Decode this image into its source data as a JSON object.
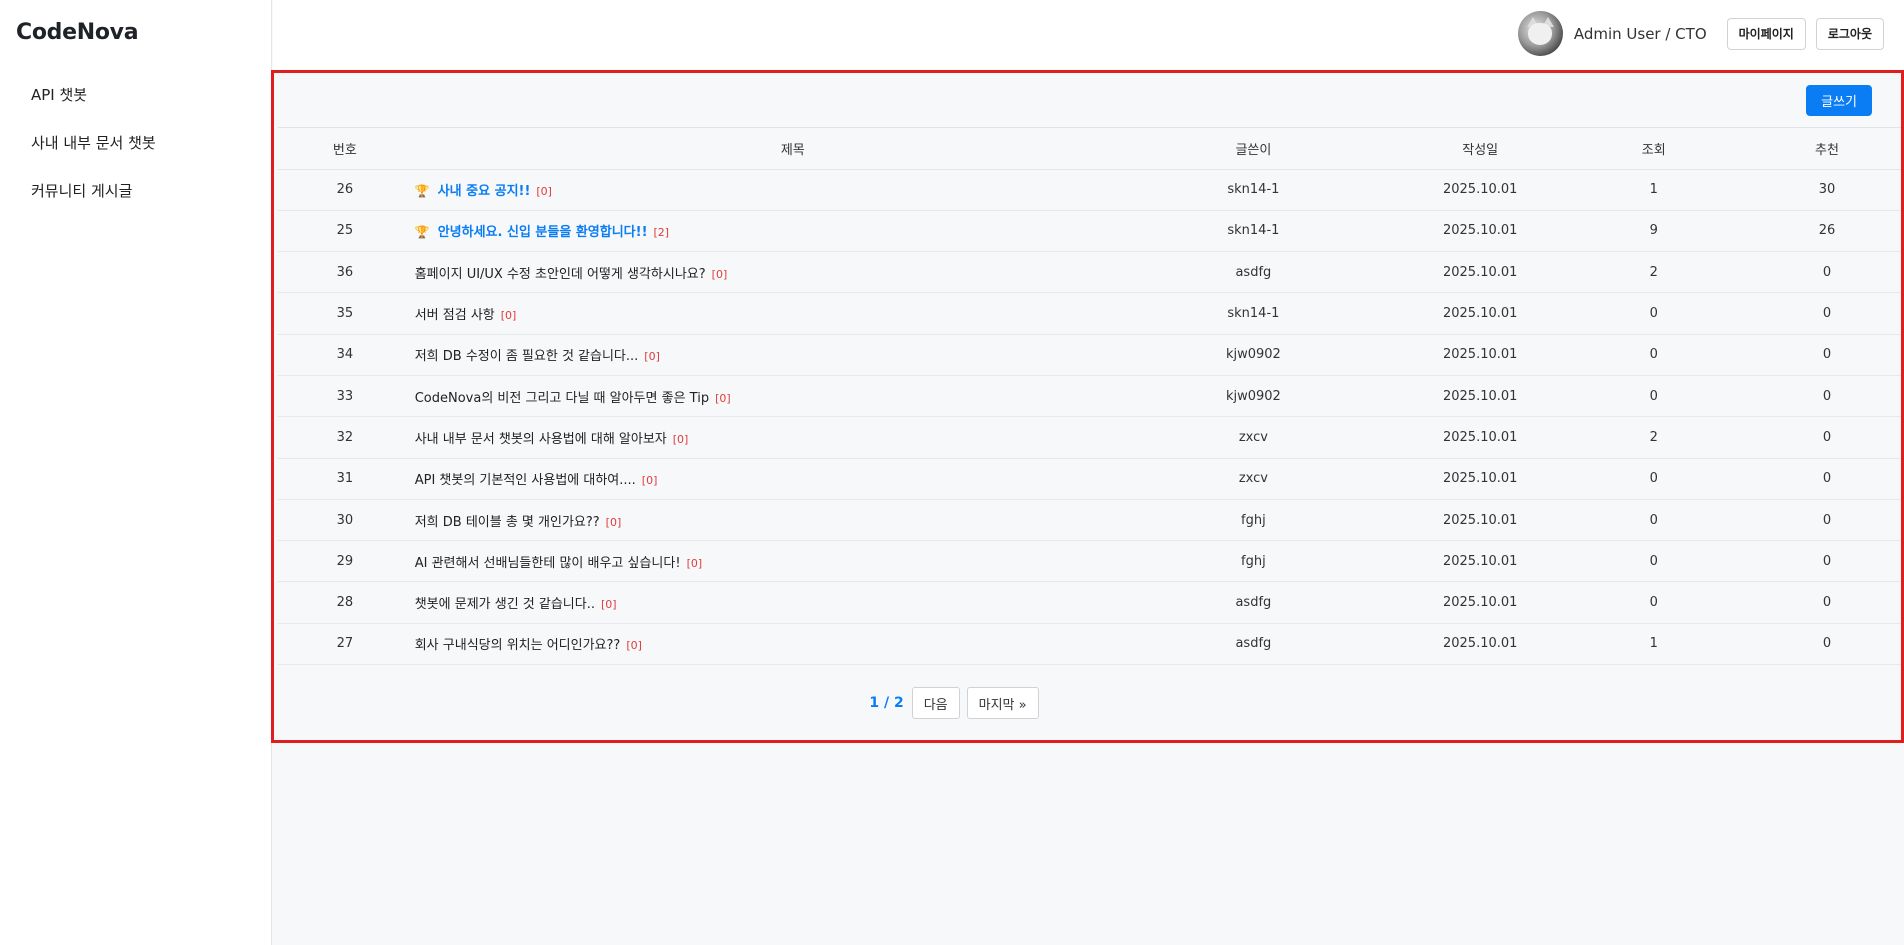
{
  "app": {
    "logo": "CodeNova"
  },
  "sidebar": {
    "items": [
      {
        "label": "API 챗봇"
      },
      {
        "label": "사내 내부 문서 챗봇"
      },
      {
        "label": "커뮤니티 게시글"
      }
    ]
  },
  "header": {
    "user_label": "Admin User / CTO",
    "mypage_label": "마이페이지",
    "logout_label": "로그아웃"
  },
  "board": {
    "write_label": "글쓰기",
    "columns": {
      "no": "번호",
      "title": "제목",
      "author": "글쓴이",
      "date": "작성일",
      "views": "조회",
      "recommend": "추천"
    },
    "rows": [
      {
        "no": "26",
        "title": "사내 중요 공지!!",
        "comments": "[0]",
        "author": "skn14-1",
        "date": "2025.10.01",
        "views": "1",
        "recommend": "30",
        "pinned": true
      },
      {
        "no": "25",
        "title": "안녕하세요. 신입 분들을 환영합니다!!",
        "comments": "[2]",
        "author": "skn14-1",
        "date": "2025.10.01",
        "views": "9",
        "recommend": "26",
        "pinned": true
      },
      {
        "no": "36",
        "title": "홈페이지 UI/UX 수정 초안인데 어떻게 생각하시나요?",
        "comments": "[0]",
        "author": "asdfg",
        "date": "2025.10.01",
        "views": "2",
        "recommend": "0",
        "pinned": false
      },
      {
        "no": "35",
        "title": "서버 점검 사항",
        "comments": "[0]",
        "author": "skn14-1",
        "date": "2025.10.01",
        "views": "0",
        "recommend": "0",
        "pinned": false
      },
      {
        "no": "34",
        "title": "저희 DB 수정이 좀 필요한 것 같습니다...",
        "comments": "[0]",
        "author": "kjw0902",
        "date": "2025.10.01",
        "views": "0",
        "recommend": "0",
        "pinned": false
      },
      {
        "no": "33",
        "title": "CodeNova의 비전 그리고 다닐 때 알아두면 좋은 Tip",
        "comments": "[0]",
        "author": "kjw0902",
        "date": "2025.10.01",
        "views": "0",
        "recommend": "0",
        "pinned": false
      },
      {
        "no": "32",
        "title": "사내 내부 문서 챗봇의 사용법에 대해 알아보자",
        "comments": "[0]",
        "author": "zxcv",
        "date": "2025.10.01",
        "views": "2",
        "recommend": "0",
        "pinned": false
      },
      {
        "no": "31",
        "title": "API 챗봇의 기본적인 사용법에 대하여....",
        "comments": "[0]",
        "author": "zxcv",
        "date": "2025.10.01",
        "views": "0",
        "recommend": "0",
        "pinned": false
      },
      {
        "no": "30",
        "title": "저희 DB 테이블 총 몇 개인가요??",
        "comments": "[0]",
        "author": "fghj",
        "date": "2025.10.01",
        "views": "0",
        "recommend": "0",
        "pinned": false
      },
      {
        "no": "29",
        "title": "AI 관련해서 선배님들한테 많이 배우고 싶습니다!",
        "comments": "[0]",
        "author": "fghj",
        "date": "2025.10.01",
        "views": "0",
        "recommend": "0",
        "pinned": false
      },
      {
        "no": "28",
        "title": "챗봇에 문제가 생긴 것 같습니다..",
        "comments": "[0]",
        "author": "asdfg",
        "date": "2025.10.01",
        "views": "0",
        "recommend": "0",
        "pinned": false
      },
      {
        "no": "27",
        "title": "회사 구내식당의 위치는 어디인가요??",
        "comments": "[0]",
        "author": "asdfg",
        "date": "2025.10.01",
        "views": "1",
        "recommend": "0",
        "pinned": false
      }
    ]
  },
  "pagination": {
    "info": "1 / 2",
    "next_label": "다음",
    "last_label": "마지막 »"
  },
  "icons": {
    "pinned": "trophy-icon",
    "avatar": "cat-avatar"
  },
  "colors": {
    "accent": "#0a7df4",
    "comment_count": "#e03c3c",
    "highlight_border": "#e01e1e"
  }
}
